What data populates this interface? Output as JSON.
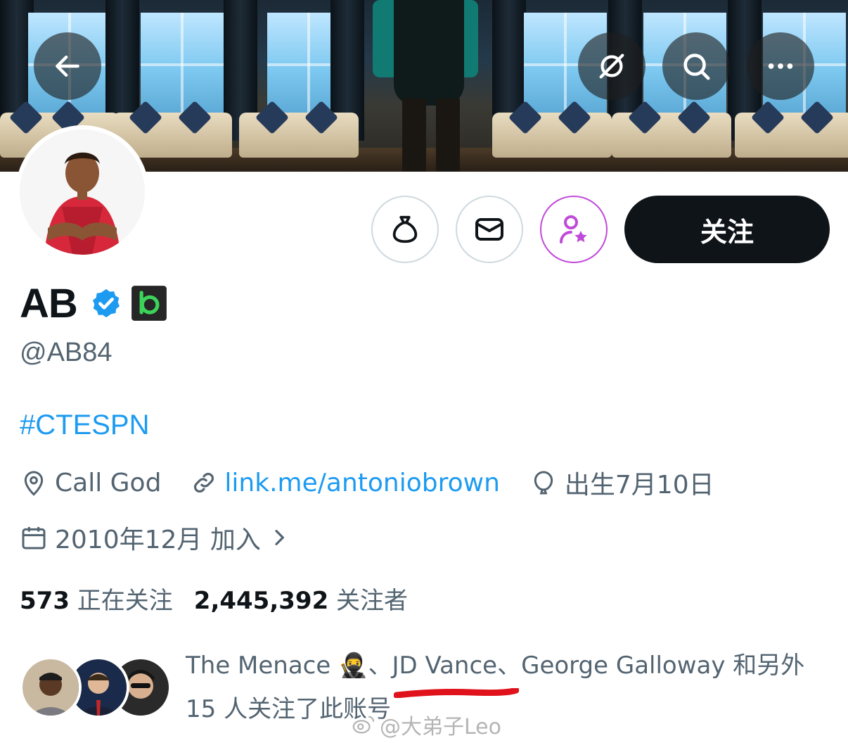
{
  "header": {
    "back_icon": "arrow-left-icon",
    "grok_icon": "grok-icon",
    "search_icon": "search-icon",
    "more_icon": "more-horizontal-icon"
  },
  "profile": {
    "display_name": "AB",
    "verified_badge": "verified-badge-icon",
    "handle": "@AB84",
    "bio": "#CTESPN",
    "location": "Call God",
    "website": "link.me/antoniobrown",
    "birthday": "出生7月10日",
    "joined": "2010年12月 加入"
  },
  "actions": {
    "follow_label": "关注"
  },
  "stats": {
    "following_count": "573",
    "following_label": "正在关注",
    "followers_count": "2,445,392",
    "followers_label": "关注者"
  },
  "followers_you_know": {
    "line1_prefix": "The Menace ",
    "line1_emoji": "🥷",
    "line1_sep": "、",
    "name2": "JD Vance",
    "line1_rest": "、George Galloway 和另外",
    "line2": "15 人关注了此账号"
  },
  "watermark": "@大弟子Leo",
  "colors": {
    "link": "#1d9bf0",
    "verified": "#1d9bf0",
    "subscribe": "#c04ad8",
    "annotation": "#e0121b"
  }
}
